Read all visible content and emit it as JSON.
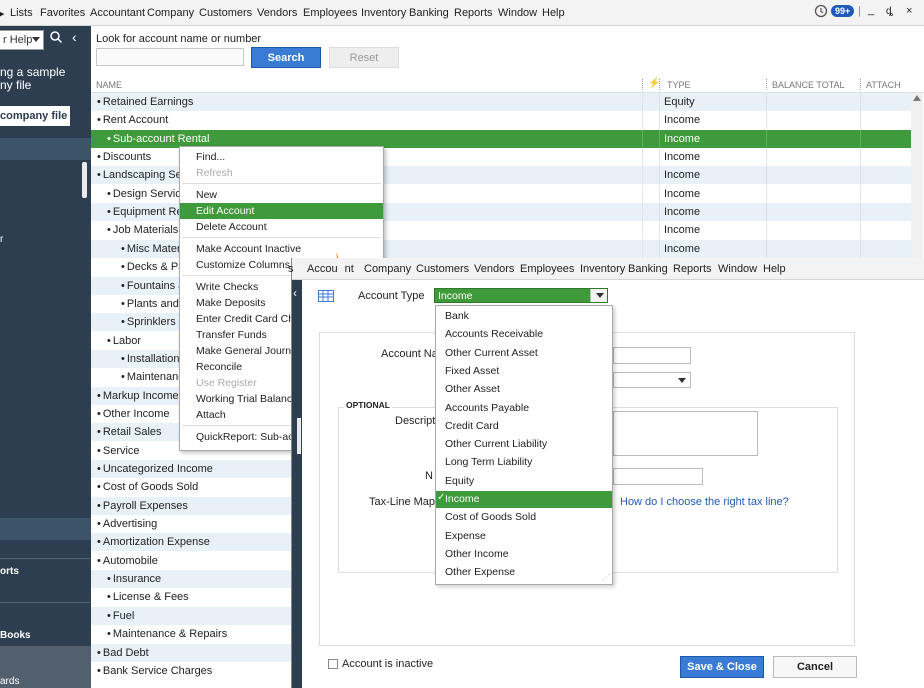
{
  "menubar": {
    "items": [
      "Lists",
      "Favorites",
      "Accountant",
      "Company",
      "Customers",
      "Vendors",
      "Employees",
      "Inventory",
      "Banking",
      "Reports",
      "Window",
      "Help"
    ],
    "badge": "99+",
    "win_min": "_",
    "win_restore": "ȡ",
    "win_close": "×"
  },
  "sidebar": {
    "search_text": "r Help",
    "sample_line1": "ng a sample",
    "sample_line2": "ny file",
    "open_button": "company file",
    "r_label": "r",
    "reports_label": "orts",
    "books_label": "Books",
    "cards_label": "ards"
  },
  "search": {
    "look_label": "Look for account name or number",
    "search_button": "Search",
    "reset_button": "Reset"
  },
  "columns": {
    "name": "NAME",
    "attach_icon": "⚡",
    "type": "TYPE",
    "balance_total": "BALANCE TOTAL",
    "attach": "ATTACH"
  },
  "accounts": [
    {
      "name": "Retained Earnings",
      "type": "Equity",
      "indent": 0
    },
    {
      "name": "Rent Account",
      "type": "Income",
      "indent": 0
    },
    {
      "name": "Sub-account Rental",
      "type": "Income",
      "indent": 1
    },
    {
      "name": "Discounts",
      "type": "Income",
      "indent": 0
    },
    {
      "name": "Landscaping Serv",
      "type": "Income",
      "indent": 0
    },
    {
      "name": "Design Service",
      "type": "Income",
      "indent": 1
    },
    {
      "name": "Equipment Rer",
      "type": "Income",
      "indent": 1
    },
    {
      "name": "Job Materials",
      "type": "Income",
      "indent": 1
    },
    {
      "name": "Misc Materia",
      "type": "Income",
      "indent": 2
    },
    {
      "name": "Decks & Pa",
      "type": "",
      "indent": 2
    },
    {
      "name": "Fountains &",
      "type": "",
      "indent": 2
    },
    {
      "name": "Plants and S",
      "type": "",
      "indent": 2
    },
    {
      "name": "Sprinklers &",
      "type": "",
      "indent": 2
    },
    {
      "name": "Labor",
      "type": "",
      "indent": 1
    },
    {
      "name": "Installation",
      "type": "",
      "indent": 2
    },
    {
      "name": "Maintenanc",
      "type": "",
      "indent": 2
    },
    {
      "name": "Markup Income",
      "type": "",
      "indent": 0
    },
    {
      "name": "Other Income",
      "type": "",
      "indent": 0
    },
    {
      "name": "Retail Sales",
      "type": "",
      "indent": 0
    },
    {
      "name": "Service",
      "type": "",
      "indent": 0
    },
    {
      "name": "Uncategorized Income",
      "type": "",
      "indent": 0
    },
    {
      "name": "Cost of Goods Sold",
      "type": "",
      "indent": 0
    },
    {
      "name": "Payroll Expenses",
      "type": "",
      "indent": 0
    },
    {
      "name": "Advertising",
      "type": "",
      "indent": 0
    },
    {
      "name": "Amortization Expense",
      "type": "",
      "indent": 0
    },
    {
      "name": "Automobile",
      "type": "",
      "indent": 0
    },
    {
      "name": "Insurance",
      "type": "",
      "indent": 1
    },
    {
      "name": "License & Fees",
      "type": "",
      "indent": 1
    },
    {
      "name": "Fuel",
      "type": "",
      "indent": 1
    },
    {
      "name": "Maintenance & Repairs",
      "type": "",
      "indent": 1
    },
    {
      "name": "Bad Debt",
      "type": "",
      "indent": 0
    },
    {
      "name": "Bank Service Charges",
      "type": "",
      "indent": 0
    }
  ],
  "bullet": "•",
  "context_menu": [
    {
      "label": "Find...",
      "state": "normal"
    },
    {
      "label": "Refresh",
      "state": "disabled"
    },
    {
      "label": "sep"
    },
    {
      "label": "New",
      "state": "normal"
    },
    {
      "label": "Edit Account",
      "state": "highlighted"
    },
    {
      "label": "Delete Account",
      "state": "normal"
    },
    {
      "label": "sep"
    },
    {
      "label": "Make Account Inactive",
      "state": "normal"
    },
    {
      "label": "Customize Columns...",
      "state": "normal"
    },
    {
      "label": "sep"
    },
    {
      "label": "Write Checks",
      "state": "normal"
    },
    {
      "label": "Make Deposits",
      "state": "normal"
    },
    {
      "label": "Enter Credit Card Cha",
      "state": "normal"
    },
    {
      "label": "Transfer Funds",
      "state": "normal"
    },
    {
      "label": "Make General Journal",
      "state": "normal"
    },
    {
      "label": "Reconcile",
      "state": "normal"
    },
    {
      "label": "Use Register",
      "state": "disabled"
    },
    {
      "label": "Working Trial Balance",
      "state": "normal"
    },
    {
      "label": "Attach",
      "state": "normal"
    },
    {
      "label": "sep"
    },
    {
      "label": "QuickReport: Sub-acc",
      "state": "normal"
    }
  ],
  "edit_window": {
    "menubar": [
      "s",
      "Accou",
      "nt",
      "Company",
      "Customers",
      "Vendors",
      "Employees",
      "Inventory",
      "Banking",
      "Reports",
      "Window",
      "Help"
    ],
    "collapse_icon": "‹",
    "account_type_label": "Account Type",
    "account_type_value": "Income",
    "account_name_label": "Account Na",
    "optional_label": "OPTIONAL",
    "description_label": "Descripti",
    "note_label": "N",
    "taxline_label": "Tax-Line Mappi",
    "taxline_link": "How do I choose the right tax line?",
    "inactive_label": "Account is inactive",
    "save_close": "Save & Close",
    "cancel": "Cancel",
    "types": [
      "Bank",
      "Accounts Receivable",
      "Other Current Asset",
      "Fixed Asset",
      "Other Asset",
      "Accounts Payable",
      "Credit Card",
      "Other Current Liability",
      "Long Term Liability",
      "Equity",
      "Income",
      "Cost of Goods Sold",
      "Expense",
      "Other Income",
      "Other Expense"
    ],
    "selected_type": "Income",
    "check": "✓",
    "grip": "⋰"
  },
  "colors": {
    "sidebar": "#2c3e50",
    "selection_green": "#3e9a3a",
    "alt_row": "#e9f1f8",
    "button_blue": "#3a7bd5",
    "arrow_orange": "#f08a24"
  }
}
